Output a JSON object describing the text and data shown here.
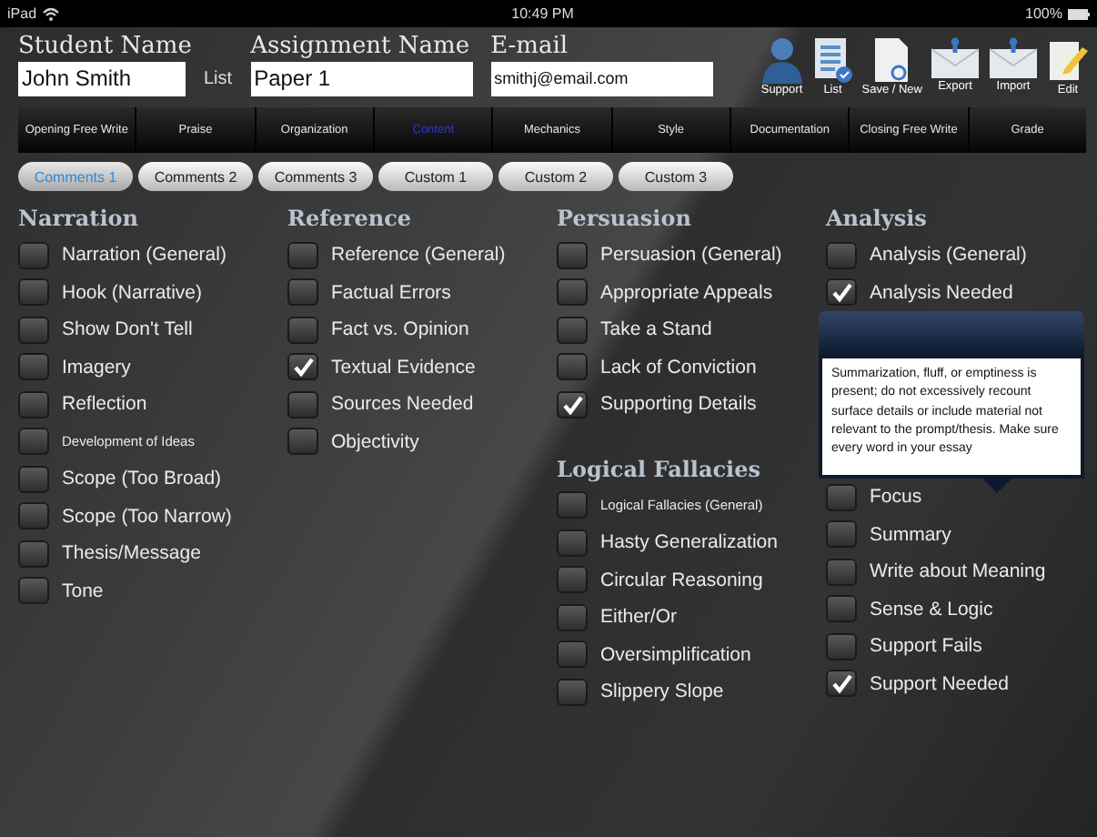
{
  "status_bar": {
    "device": "iPad",
    "time": "10:49 PM",
    "battery": "100%"
  },
  "fields": [
    {
      "label": "Student Name",
      "value": "John Smith",
      "kind": "student"
    },
    {
      "label": "Assignment Name",
      "value": "Paper 1",
      "kind": "assignment"
    },
    {
      "label": "E-mail",
      "value": "smithj@email.com",
      "kind": "email"
    }
  ],
  "list_link": "List",
  "toolbar": [
    {
      "label": "Support",
      "kind": "person"
    },
    {
      "label": "List",
      "kind": "list"
    },
    {
      "label": "Save / New",
      "kind": "page"
    },
    {
      "label": "Export",
      "kind": "export"
    },
    {
      "label": "Import",
      "kind": "import"
    },
    {
      "label": "Edit",
      "kind": "edit"
    }
  ],
  "category_tabs": [
    {
      "label": "Opening Free Write",
      "selected": false
    },
    {
      "label": "Praise",
      "selected": false
    },
    {
      "label": "Organization",
      "selected": false
    },
    {
      "label": "Content",
      "selected": true
    },
    {
      "label": "Mechanics",
      "selected": false
    },
    {
      "label": "Style",
      "selected": false
    },
    {
      "label": "Documentation",
      "selected": false
    },
    {
      "label": "Closing Free Write",
      "selected": false
    },
    {
      "label": "Grade",
      "selected": false
    }
  ],
  "comment_tabs": [
    {
      "label": "Comments 1",
      "selected": true
    },
    {
      "label": "Comments 2",
      "selected": false
    },
    {
      "label": "Comments 3",
      "selected": false
    },
    {
      "label": "Custom 1",
      "selected": false
    },
    {
      "label": "Custom 2",
      "selected": false
    },
    {
      "label": "Custom 3",
      "selected": false
    }
  ],
  "columns": [
    {
      "sections": [
        {
          "title": "Narration",
          "items": [
            {
              "label": "Narration (General)",
              "checked": false,
              "kind": "normal"
            },
            {
              "label": "Hook (Narrative)",
              "checked": false,
              "kind": "normal"
            },
            {
              "label": "Show Don't Tell",
              "checked": false,
              "kind": "normal"
            },
            {
              "label": "Imagery",
              "checked": false,
              "kind": "normal"
            },
            {
              "label": "Reflection",
              "checked": false,
              "kind": "normal"
            },
            {
              "label": "Development of Ideas",
              "checked": false,
              "kind": "compact"
            },
            {
              "label": "Scope (Too Broad)",
              "checked": false,
              "kind": "normal"
            },
            {
              "label": "Scope (Too Narrow)",
              "checked": false,
              "kind": "normal"
            },
            {
              "label": "Thesis/Message",
              "checked": false,
              "kind": "normal"
            },
            {
              "label": "Tone",
              "checked": false,
              "kind": "normal"
            }
          ]
        }
      ]
    },
    {
      "sections": [
        {
          "title": "Reference",
          "items": [
            {
              "label": "Reference (General)",
              "checked": false,
              "kind": "normal"
            },
            {
              "label": "Factual Errors",
              "checked": false,
              "kind": "normal"
            },
            {
              "label": "Fact vs. Opinion",
              "checked": false,
              "kind": "normal"
            },
            {
              "label": "Textual Evidence",
              "checked": true,
              "kind": "normal"
            },
            {
              "label": "Sources Needed",
              "checked": false,
              "kind": "normal"
            },
            {
              "label": "Objectivity",
              "checked": false,
              "kind": "normal"
            }
          ]
        }
      ]
    },
    {
      "sections": [
        {
          "title": "Persuasion",
          "items": [
            {
              "label": "Persuasion (General)",
              "checked": false,
              "kind": "normal"
            },
            {
              "label": "Appropriate Appeals",
              "checked": false,
              "kind": "normal"
            },
            {
              "label": "Take a Stand",
              "checked": false,
              "kind": "normal"
            },
            {
              "label": "Lack of Conviction",
              "checked": false,
              "kind": "normal"
            },
            {
              "label": "Supporting Details",
              "checked": true,
              "kind": "normal"
            }
          ]
        },
        {
          "title": "Logical Fallacies",
          "items": [
            {
              "label": "Logical Fallacies (General)",
              "checked": false,
              "kind": "compact"
            },
            {
              "label": "Hasty Generalization",
              "checked": false,
              "kind": "normal"
            },
            {
              "label": "Circular Reasoning",
              "checked": false,
              "kind": "normal"
            },
            {
              "label": "Either/Or",
              "checked": false,
              "kind": "normal"
            },
            {
              "label": "Oversimplification",
              "checked": false,
              "kind": "normal"
            },
            {
              "label": "Slippery Slope",
              "checked": false,
              "kind": "normal"
            }
          ]
        }
      ]
    },
    {
      "sections": [
        {
          "title": "Analysis",
          "items": [
            {
              "label": "Analysis (General)",
              "checked": false,
              "kind": "normal"
            },
            {
              "label": "Analysis Needed",
              "checked": true,
              "kind": "normal"
            }
          ]
        },
        {
          "tooltip": {
            "text": "Summarization, fluff, or emptiness is present; do not excessively recount surface details or include material not relevant to the prompt/thesis. Make sure every word in your essay"
          },
          "items": [
            {
              "label": "Focus",
              "checked": false,
              "kind": "normal"
            },
            {
              "label": "Summary",
              "checked": false,
              "kind": "normal"
            },
            {
              "label": "Write about Meaning",
              "checked": false,
              "kind": "normal"
            },
            {
              "label": "Sense & Logic",
              "checked": false,
              "kind": "normal"
            },
            {
              "label": "Support Fails",
              "checked": false,
              "kind": "normal"
            },
            {
              "label": "Support Needed",
              "checked": true,
              "kind": "normal"
            }
          ]
        }
      ]
    }
  ]
}
